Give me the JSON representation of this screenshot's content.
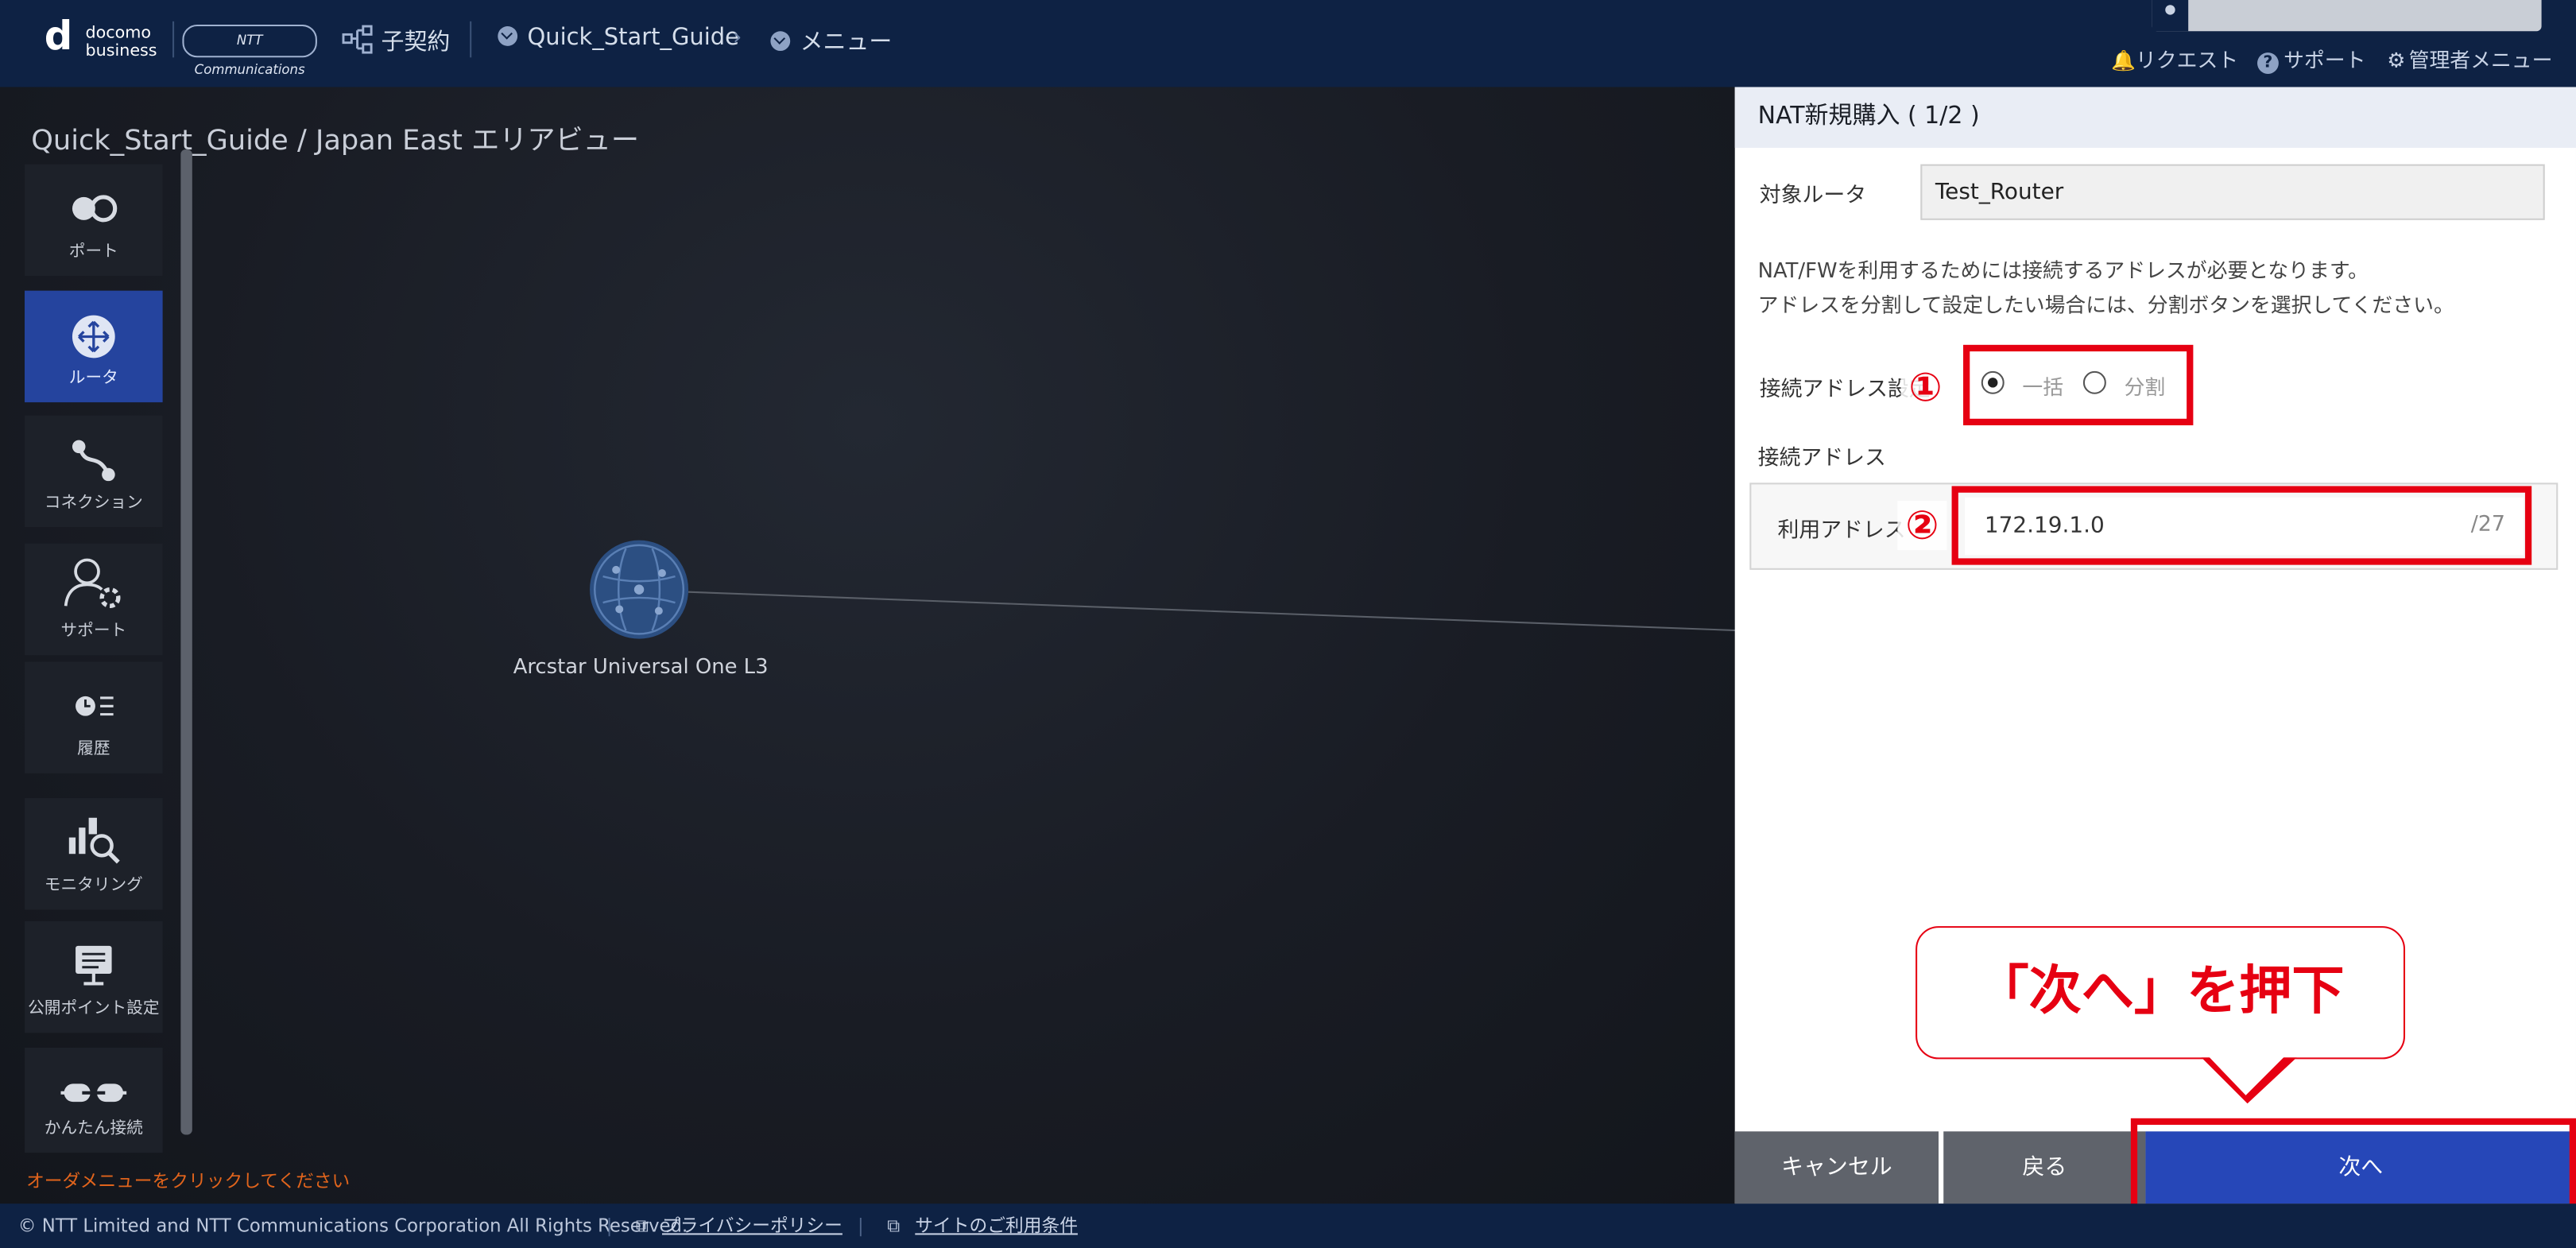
{
  "header": {
    "logo_line1": "docomo",
    "logo_line2": "business",
    "ntt_logo": "NTT Communications",
    "contract": "子契約",
    "breadcrumb_project": "Quick_Start_Guide",
    "menu": "メニュー",
    "request": "リクエスト",
    "support": "サポート",
    "admin_menu": "管理者メニュー"
  },
  "main": {
    "area_title": "Quick_Start_Guide / Japan East エリアビュー",
    "order_note": "オーダメニューをクリックしてください",
    "node_label": "Arcstar Universal One L3"
  },
  "sidebar": {
    "items": [
      {
        "label": "ポート",
        "icon": "port-icon"
      },
      {
        "label": "ルータ",
        "icon": "router-icon"
      },
      {
        "label": "コネクション",
        "icon": "connection-icon"
      },
      {
        "label": "サポート",
        "icon": "support-icon"
      },
      {
        "label": "履歴",
        "icon": "history-icon"
      },
      {
        "label": "モニタリング",
        "icon": "monitoring-icon"
      },
      {
        "label": "公開ポイント設定",
        "icon": "public-point-icon"
      },
      {
        "label": "かんたん接続",
        "icon": "easy-connect-icon"
      }
    ]
  },
  "panel": {
    "title": "NAT新規購入 ( 1/2 )",
    "target_router_label": "対象ルータ",
    "target_router_value": "Test_Router",
    "notice_line1": "NAT/FWを利用するためには接続するアドレスが必要となります。",
    "notice_line2": "アドレスを分割して設定したい場合には、分割ボタンを選択してください。",
    "address_setting_label": "接続アドレス設定",
    "option_bulk": "一括",
    "option_split": "分割",
    "selected_option": "一括",
    "address_section_label": "接続アドレス",
    "use_address_label": "利用アドレス",
    "use_address_value": "172.19.1.0",
    "prefix": "/27"
  },
  "annotations": {
    "marker1": "①",
    "marker2": "②",
    "callout": "「次へ」を押下",
    "accent": "#e60012"
  },
  "buttons": {
    "cancel": "キャンセル",
    "back": "戻る",
    "next": "次へ"
  },
  "footer": {
    "copyright": "© NTT Limited and NTT Communications Corporation All Rights Reserved.",
    "privacy": "プライバシーポリシー",
    "terms": "サイトのご利用条件"
  },
  "colors": {
    "header_bg": "#0e2244",
    "active_sidebar": "#25449e",
    "next_button": "#2647b8",
    "order_note": "#e1641c"
  }
}
